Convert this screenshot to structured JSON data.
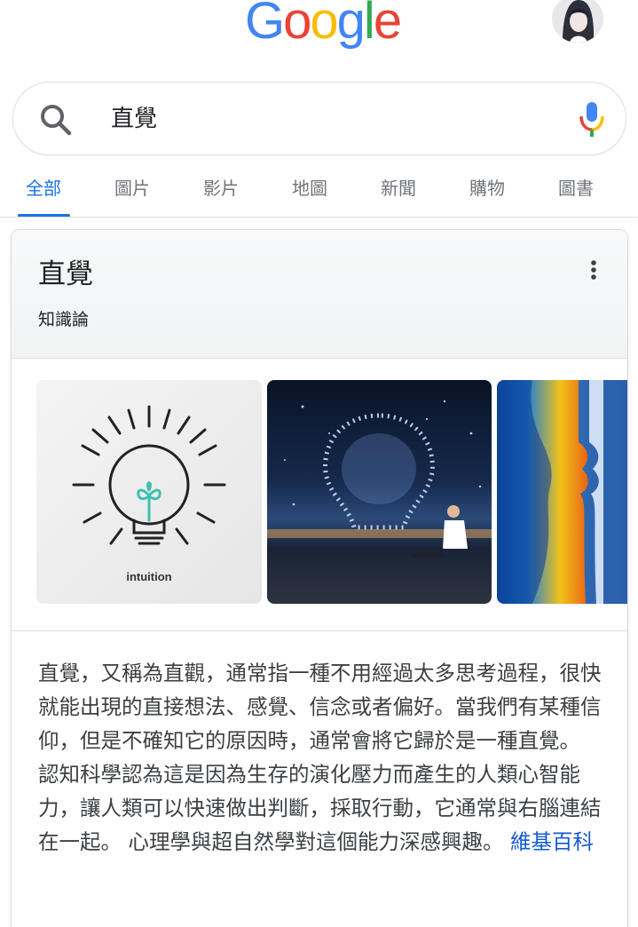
{
  "header": {
    "logo_letters": [
      {
        "char": "G",
        "color": "#4285F4"
      },
      {
        "char": "o",
        "color": "#EA4335"
      },
      {
        "char": "o",
        "color": "#FBBC05"
      },
      {
        "char": "g",
        "color": "#4285F4"
      },
      {
        "char": "l",
        "color": "#34A853"
      },
      {
        "char": "e",
        "color": "#EA4335"
      }
    ],
    "avatar_icon": "user-avatar-icon"
  },
  "search": {
    "query": "直覺",
    "search_icon": "search-icon",
    "mic_icon": "mic-icon"
  },
  "tabs": [
    {
      "label": "全部",
      "active": true
    },
    {
      "label": "圖片",
      "active": false
    },
    {
      "label": "影片",
      "active": false
    },
    {
      "label": "地圖",
      "active": false
    },
    {
      "label": "新聞",
      "active": false
    },
    {
      "label": "購物",
      "active": false
    },
    {
      "label": "圖書",
      "active": false
    }
  ],
  "knowledge_panel": {
    "title": "直覺",
    "subtitle": "知識論",
    "menu_icon": "more-vert-icon",
    "images": [
      {
        "name": "lightbulb-sketch-image",
        "caption": "intuition"
      },
      {
        "name": "galaxy-lightbulb-image"
      },
      {
        "name": "face-silhouettes-image"
      }
    ],
    "description": "直覺，又稱為直觀，通常指一種不用經過太多思考過程，很快就能出現的直接想法、感覺、信念或者偏好。當我們有某種信仰，但是不確知它的原因時，通常會將它歸於是一種直覺。 認知科學認為這是因為生存的演化壓力而產生的人類心智能力，讓人類可以快速做出判斷，採取行動，它通常與右腦連結在一起。 心理學與超自然學對這個能力深感興趣。 ",
    "source_link": "維基百科"
  },
  "colors": {
    "accent_blue": "#1a73e8",
    "link_blue": "#1558d6",
    "tab_gray": "#70757a"
  }
}
